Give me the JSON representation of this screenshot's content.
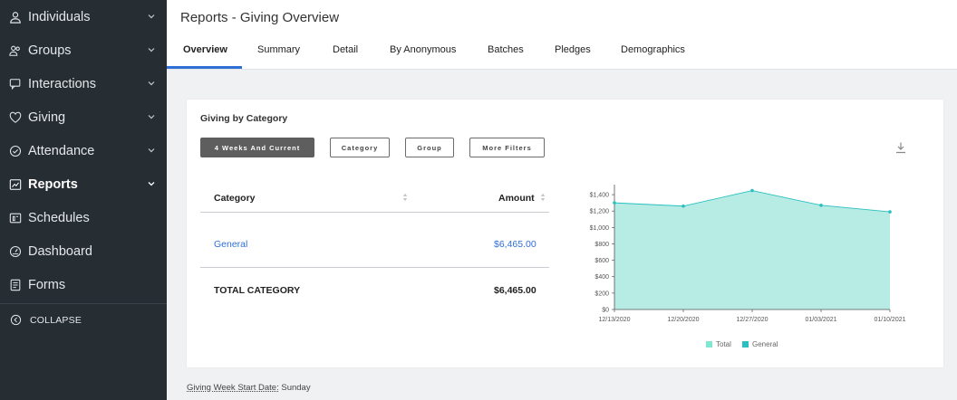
{
  "sidebar": {
    "items": [
      {
        "label": "Individuals",
        "icon": "person-icon",
        "active": false,
        "chevron": true
      },
      {
        "label": "Groups",
        "icon": "group-icon",
        "active": false,
        "chevron": true
      },
      {
        "label": "Interactions",
        "icon": "chat-icon",
        "active": false,
        "chevron": true
      },
      {
        "label": "Giving",
        "icon": "heart-icon",
        "active": false,
        "chevron": true
      },
      {
        "label": "Attendance",
        "icon": "check-circle-icon",
        "active": false,
        "chevron": true
      },
      {
        "label": "Reports",
        "icon": "chart-icon",
        "active": true,
        "chevron": true
      },
      {
        "label": "Schedules",
        "icon": "schedule-icon",
        "active": false,
        "chevron": false
      },
      {
        "label": "Dashboard",
        "icon": "gauge-icon",
        "active": false,
        "chevron": false
      },
      {
        "label": "Forms",
        "icon": "form-icon",
        "active": false,
        "chevron": false
      }
    ],
    "collapse_label": "COLLAPSE"
  },
  "header": {
    "title": "Reports - Giving Overview",
    "tabs": [
      "Overview",
      "Summary",
      "Detail",
      "By Anonymous",
      "Batches",
      "Pledges",
      "Demographics"
    ],
    "active_tab": "Overview"
  },
  "card": {
    "title": "Giving by Category",
    "filters": [
      "4 Weeks And Current",
      "Category",
      "Group",
      "More Filters"
    ],
    "table": {
      "headers": {
        "category": "Category",
        "amount": "Amount"
      },
      "rows": [
        {
          "category": "General",
          "amount": "$6,465.00"
        }
      ],
      "total": {
        "label": "TOTAL CATEGORY",
        "amount": "$6,465.00"
      }
    }
  },
  "chart_data": {
    "type": "area",
    "x": [
      "12/13/2020",
      "12/20/2020",
      "12/27/2020",
      "01/03/2021",
      "01/10/2021"
    ],
    "series": [
      {
        "name": "Total",
        "values": [
          1300,
          1260,
          1450,
          1270,
          1190
        ]
      },
      {
        "name": "General",
        "values": [
          1300,
          1260,
          1450,
          1270,
          1190
        ]
      }
    ],
    "ylim": [
      0,
      1500
    ],
    "yticks": [
      0,
      200,
      400,
      600,
      800,
      1000,
      1200,
      1400
    ],
    "ytick_labels": [
      "$0",
      "$200",
      "$400",
      "$600",
      "$800",
      "$1,000",
      "$1,200",
      "$1,400"
    ],
    "legend_position": "bottom",
    "colors": {
      "Total": "#7ee8d2",
      "General": "#2abfc0",
      "fill": "#b6ece3"
    }
  },
  "footer": {
    "label": "Giving Week Start Date:",
    "value": "Sunday"
  }
}
